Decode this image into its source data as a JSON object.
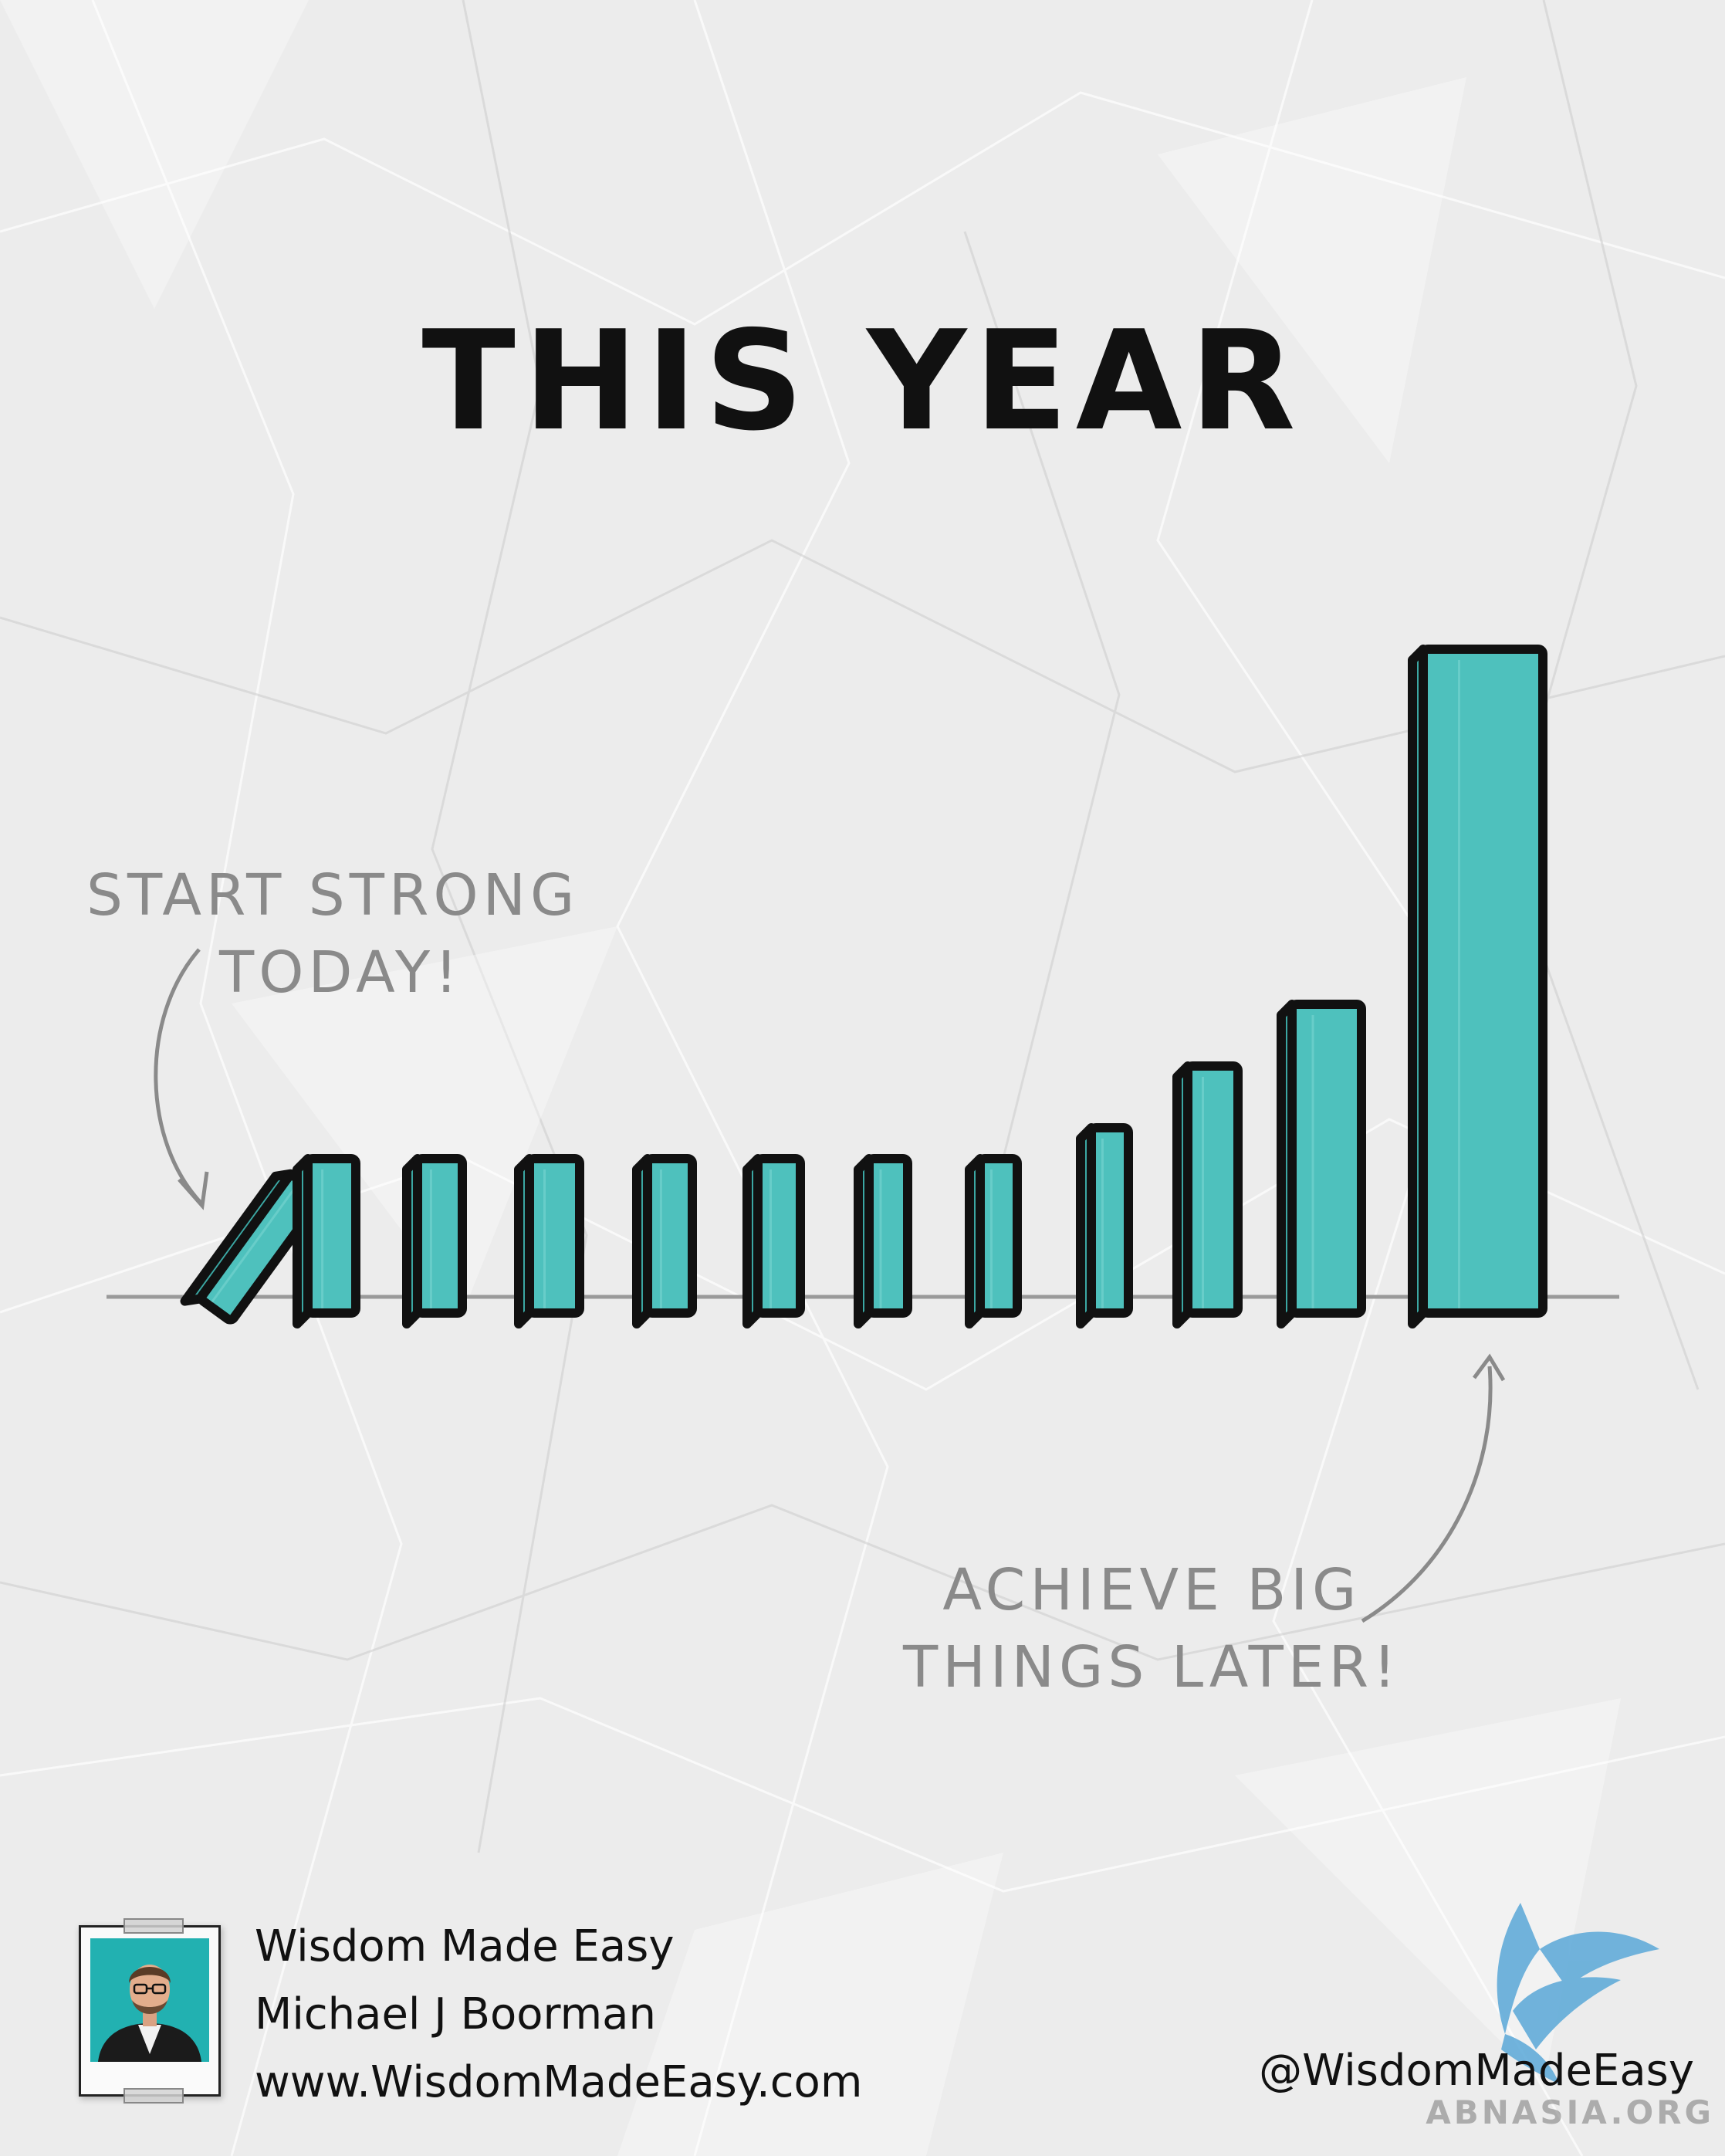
{
  "title": "THIS YEAR",
  "annotations": {
    "start": [
      "START STRONG",
      "TODAY!"
    ],
    "achieve": [
      "ACHIEVE BIG",
      "THINGS LATER!"
    ]
  },
  "dominoes": {
    "count": 12,
    "first_fallen": true,
    "relative_heights": [
      1,
      1,
      1,
      1,
      1,
      1,
      1,
      1,
      1.2,
      1.6,
      2.0,
      4.0
    ],
    "fill_color": "#4ec1bd",
    "side_color": "#3ba7a3",
    "outline_color": "#111111"
  },
  "footer": {
    "line1": "Wisdom Made Easy",
    "line2": "Michael J Boorman",
    "line3": "www.WisdomMadeEasy.com",
    "handle": "@WisdomMadeEasy",
    "avatar_bg": "#22b1b1"
  },
  "watermark": "ABNASIA.ORG",
  "icons": [
    "avatar-photo",
    "bird-logo-icon",
    "arrow-icon"
  ]
}
